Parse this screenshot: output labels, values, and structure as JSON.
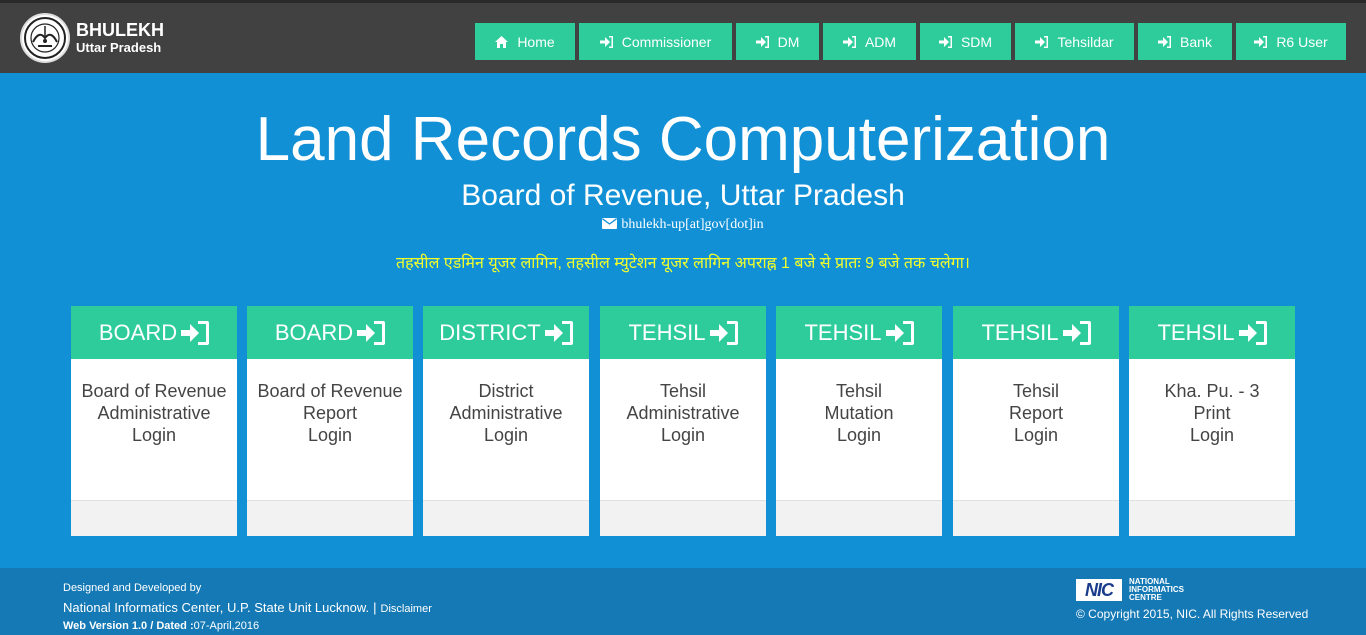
{
  "header": {
    "brand_title": "BHULEKH",
    "brand_subtitle": "Uttar Pradesh",
    "emblem": "up-state-emblem",
    "nav": [
      {
        "label": "Home",
        "icon": "home-icon"
      },
      {
        "label": "Commissioner",
        "icon": "sign-in-icon"
      },
      {
        "label": "DM",
        "icon": "sign-in-icon"
      },
      {
        "label": "ADM",
        "icon": "sign-in-icon"
      },
      {
        "label": "SDM",
        "icon": "sign-in-icon"
      },
      {
        "label": "Tehsildar",
        "icon": "sign-in-icon"
      },
      {
        "label": "Bank",
        "icon": "sign-in-icon"
      },
      {
        "label": "R6 User",
        "icon": "sign-in-icon"
      }
    ]
  },
  "hero": {
    "title": "Land Records Computerization",
    "subtitle": "Board of Revenue, Uttar Pradesh",
    "email": "bhulekh-up[at]gov[dot]in",
    "email_icon": "envelope-icon",
    "notice": "तहसील एडमिन यूजर लागिन, तहसील म्युटेशन यूजर लागिन अपराह्न 1 बजे से प्रातः 9 बजे तक चलेगा।"
  },
  "cards": [
    {
      "heading": "BOARD",
      "line1": "Board of Revenue",
      "line2": "Administrative",
      "line3": "Login"
    },
    {
      "heading": "BOARD",
      "line1": "Board of Revenue",
      "line2": "Report",
      "line3": "Login"
    },
    {
      "heading": "DISTRICT",
      "line1": "District",
      "line2": "Administrative",
      "line3": "Login"
    },
    {
      "heading": "TEHSIL",
      "line1": "Tehsil",
      "line2": "Administrative",
      "line3": "Login"
    },
    {
      "heading": "TEHSIL",
      "line1": "Tehsil",
      "line2": "Mutation",
      "line3": "Login"
    },
    {
      "heading": "TEHSIL",
      "line1": "Tehsil",
      "line2": "Report",
      "line3": "Login"
    },
    {
      "heading": "TEHSIL",
      "line1": "Kha. Pu. - 3",
      "line2": "Print",
      "line3": "Login"
    }
  ],
  "footer": {
    "designed_by": "Designed and Developed by",
    "organization": "National Informatics Center, U.P. State Unit Lucknow.",
    "separator": "|",
    "disclaimer": "Disclaimer",
    "version_label": "Web Version 1.0 / Dated :",
    "version_date": "07-April,2016",
    "nic_mark": "NIC",
    "nic_line1": "NATIONAL",
    "nic_line2": "INFORMATICS",
    "nic_line3": "CENTRE",
    "copyright": "© Copyright 2015, NIC. All Rights Reserved"
  },
  "colors": {
    "page_bg": "#1190d6",
    "topbar_bg": "#414141",
    "accent_green": "#2ecc9a",
    "notice_yellow": "#f4ff2a",
    "footer_bg": "#1579b5"
  }
}
